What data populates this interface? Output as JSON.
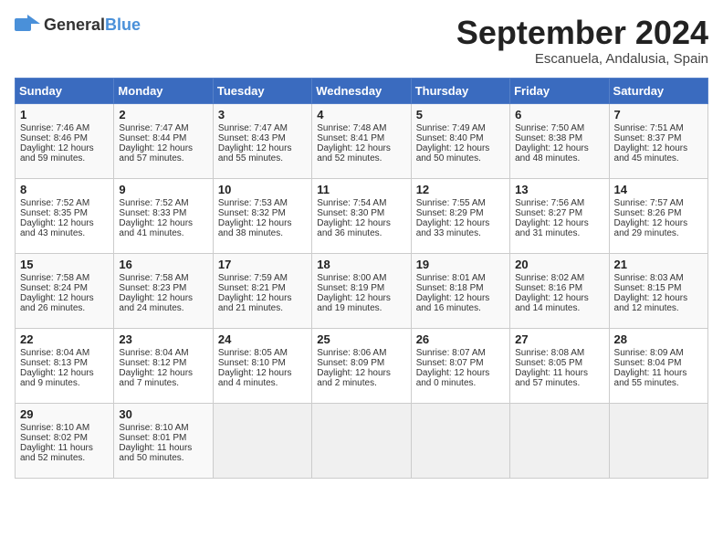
{
  "header": {
    "logo_general": "General",
    "logo_blue": "Blue",
    "month_title": "September 2024",
    "location": "Escanuela, Andalusia, Spain"
  },
  "days_of_week": [
    "Sunday",
    "Monday",
    "Tuesday",
    "Wednesday",
    "Thursday",
    "Friday",
    "Saturday"
  ],
  "weeks": [
    [
      {
        "day": "1",
        "lines": [
          "Sunrise: 7:46 AM",
          "Sunset: 8:46 PM",
          "Daylight: 12 hours",
          "and 59 minutes."
        ]
      },
      {
        "day": "2",
        "lines": [
          "Sunrise: 7:47 AM",
          "Sunset: 8:44 PM",
          "Daylight: 12 hours",
          "and 57 minutes."
        ]
      },
      {
        "day": "3",
        "lines": [
          "Sunrise: 7:47 AM",
          "Sunset: 8:43 PM",
          "Daylight: 12 hours",
          "and 55 minutes."
        ]
      },
      {
        "day": "4",
        "lines": [
          "Sunrise: 7:48 AM",
          "Sunset: 8:41 PM",
          "Daylight: 12 hours",
          "and 52 minutes."
        ]
      },
      {
        "day": "5",
        "lines": [
          "Sunrise: 7:49 AM",
          "Sunset: 8:40 PM",
          "Daylight: 12 hours",
          "and 50 minutes."
        ]
      },
      {
        "day": "6",
        "lines": [
          "Sunrise: 7:50 AM",
          "Sunset: 8:38 PM",
          "Daylight: 12 hours",
          "and 48 minutes."
        ]
      },
      {
        "day": "7",
        "lines": [
          "Sunrise: 7:51 AM",
          "Sunset: 8:37 PM",
          "Daylight: 12 hours",
          "and 45 minutes."
        ]
      }
    ],
    [
      {
        "day": "8",
        "lines": [
          "Sunrise: 7:52 AM",
          "Sunset: 8:35 PM",
          "Daylight: 12 hours",
          "and 43 minutes."
        ]
      },
      {
        "day": "9",
        "lines": [
          "Sunrise: 7:52 AM",
          "Sunset: 8:33 PM",
          "Daylight: 12 hours",
          "and 41 minutes."
        ]
      },
      {
        "day": "10",
        "lines": [
          "Sunrise: 7:53 AM",
          "Sunset: 8:32 PM",
          "Daylight: 12 hours",
          "and 38 minutes."
        ]
      },
      {
        "day": "11",
        "lines": [
          "Sunrise: 7:54 AM",
          "Sunset: 8:30 PM",
          "Daylight: 12 hours",
          "and 36 minutes."
        ]
      },
      {
        "day": "12",
        "lines": [
          "Sunrise: 7:55 AM",
          "Sunset: 8:29 PM",
          "Daylight: 12 hours",
          "and 33 minutes."
        ]
      },
      {
        "day": "13",
        "lines": [
          "Sunrise: 7:56 AM",
          "Sunset: 8:27 PM",
          "Daylight: 12 hours",
          "and 31 minutes."
        ]
      },
      {
        "day": "14",
        "lines": [
          "Sunrise: 7:57 AM",
          "Sunset: 8:26 PM",
          "Daylight: 12 hours",
          "and 29 minutes."
        ]
      }
    ],
    [
      {
        "day": "15",
        "lines": [
          "Sunrise: 7:58 AM",
          "Sunset: 8:24 PM",
          "Daylight: 12 hours",
          "and 26 minutes."
        ]
      },
      {
        "day": "16",
        "lines": [
          "Sunrise: 7:58 AM",
          "Sunset: 8:23 PM",
          "Daylight: 12 hours",
          "and 24 minutes."
        ]
      },
      {
        "day": "17",
        "lines": [
          "Sunrise: 7:59 AM",
          "Sunset: 8:21 PM",
          "Daylight: 12 hours",
          "and 21 minutes."
        ]
      },
      {
        "day": "18",
        "lines": [
          "Sunrise: 8:00 AM",
          "Sunset: 8:19 PM",
          "Daylight: 12 hours",
          "and 19 minutes."
        ]
      },
      {
        "day": "19",
        "lines": [
          "Sunrise: 8:01 AM",
          "Sunset: 8:18 PM",
          "Daylight: 12 hours",
          "and 16 minutes."
        ]
      },
      {
        "day": "20",
        "lines": [
          "Sunrise: 8:02 AM",
          "Sunset: 8:16 PM",
          "Daylight: 12 hours",
          "and 14 minutes."
        ]
      },
      {
        "day": "21",
        "lines": [
          "Sunrise: 8:03 AM",
          "Sunset: 8:15 PM",
          "Daylight: 12 hours",
          "and 12 minutes."
        ]
      }
    ],
    [
      {
        "day": "22",
        "lines": [
          "Sunrise: 8:04 AM",
          "Sunset: 8:13 PM",
          "Daylight: 12 hours",
          "and 9 minutes."
        ]
      },
      {
        "day": "23",
        "lines": [
          "Sunrise: 8:04 AM",
          "Sunset: 8:12 PM",
          "Daylight: 12 hours",
          "and 7 minutes."
        ]
      },
      {
        "day": "24",
        "lines": [
          "Sunrise: 8:05 AM",
          "Sunset: 8:10 PM",
          "Daylight: 12 hours",
          "and 4 minutes."
        ]
      },
      {
        "day": "25",
        "lines": [
          "Sunrise: 8:06 AM",
          "Sunset: 8:09 PM",
          "Daylight: 12 hours",
          "and 2 minutes."
        ]
      },
      {
        "day": "26",
        "lines": [
          "Sunrise: 8:07 AM",
          "Sunset: 8:07 PM",
          "Daylight: 12 hours",
          "and 0 minutes."
        ]
      },
      {
        "day": "27",
        "lines": [
          "Sunrise: 8:08 AM",
          "Sunset: 8:05 PM",
          "Daylight: 11 hours",
          "and 57 minutes."
        ]
      },
      {
        "day": "28",
        "lines": [
          "Sunrise: 8:09 AM",
          "Sunset: 8:04 PM",
          "Daylight: 11 hours",
          "and 55 minutes."
        ]
      }
    ],
    [
      {
        "day": "29",
        "lines": [
          "Sunrise: 8:10 AM",
          "Sunset: 8:02 PM",
          "Daylight: 11 hours",
          "and 52 minutes."
        ]
      },
      {
        "day": "30",
        "lines": [
          "Sunrise: 8:10 AM",
          "Sunset: 8:01 PM",
          "Daylight: 11 hours",
          "and 50 minutes."
        ]
      },
      {
        "day": "",
        "lines": []
      },
      {
        "day": "",
        "lines": []
      },
      {
        "day": "",
        "lines": []
      },
      {
        "day": "",
        "lines": []
      },
      {
        "day": "",
        "lines": []
      }
    ]
  ]
}
